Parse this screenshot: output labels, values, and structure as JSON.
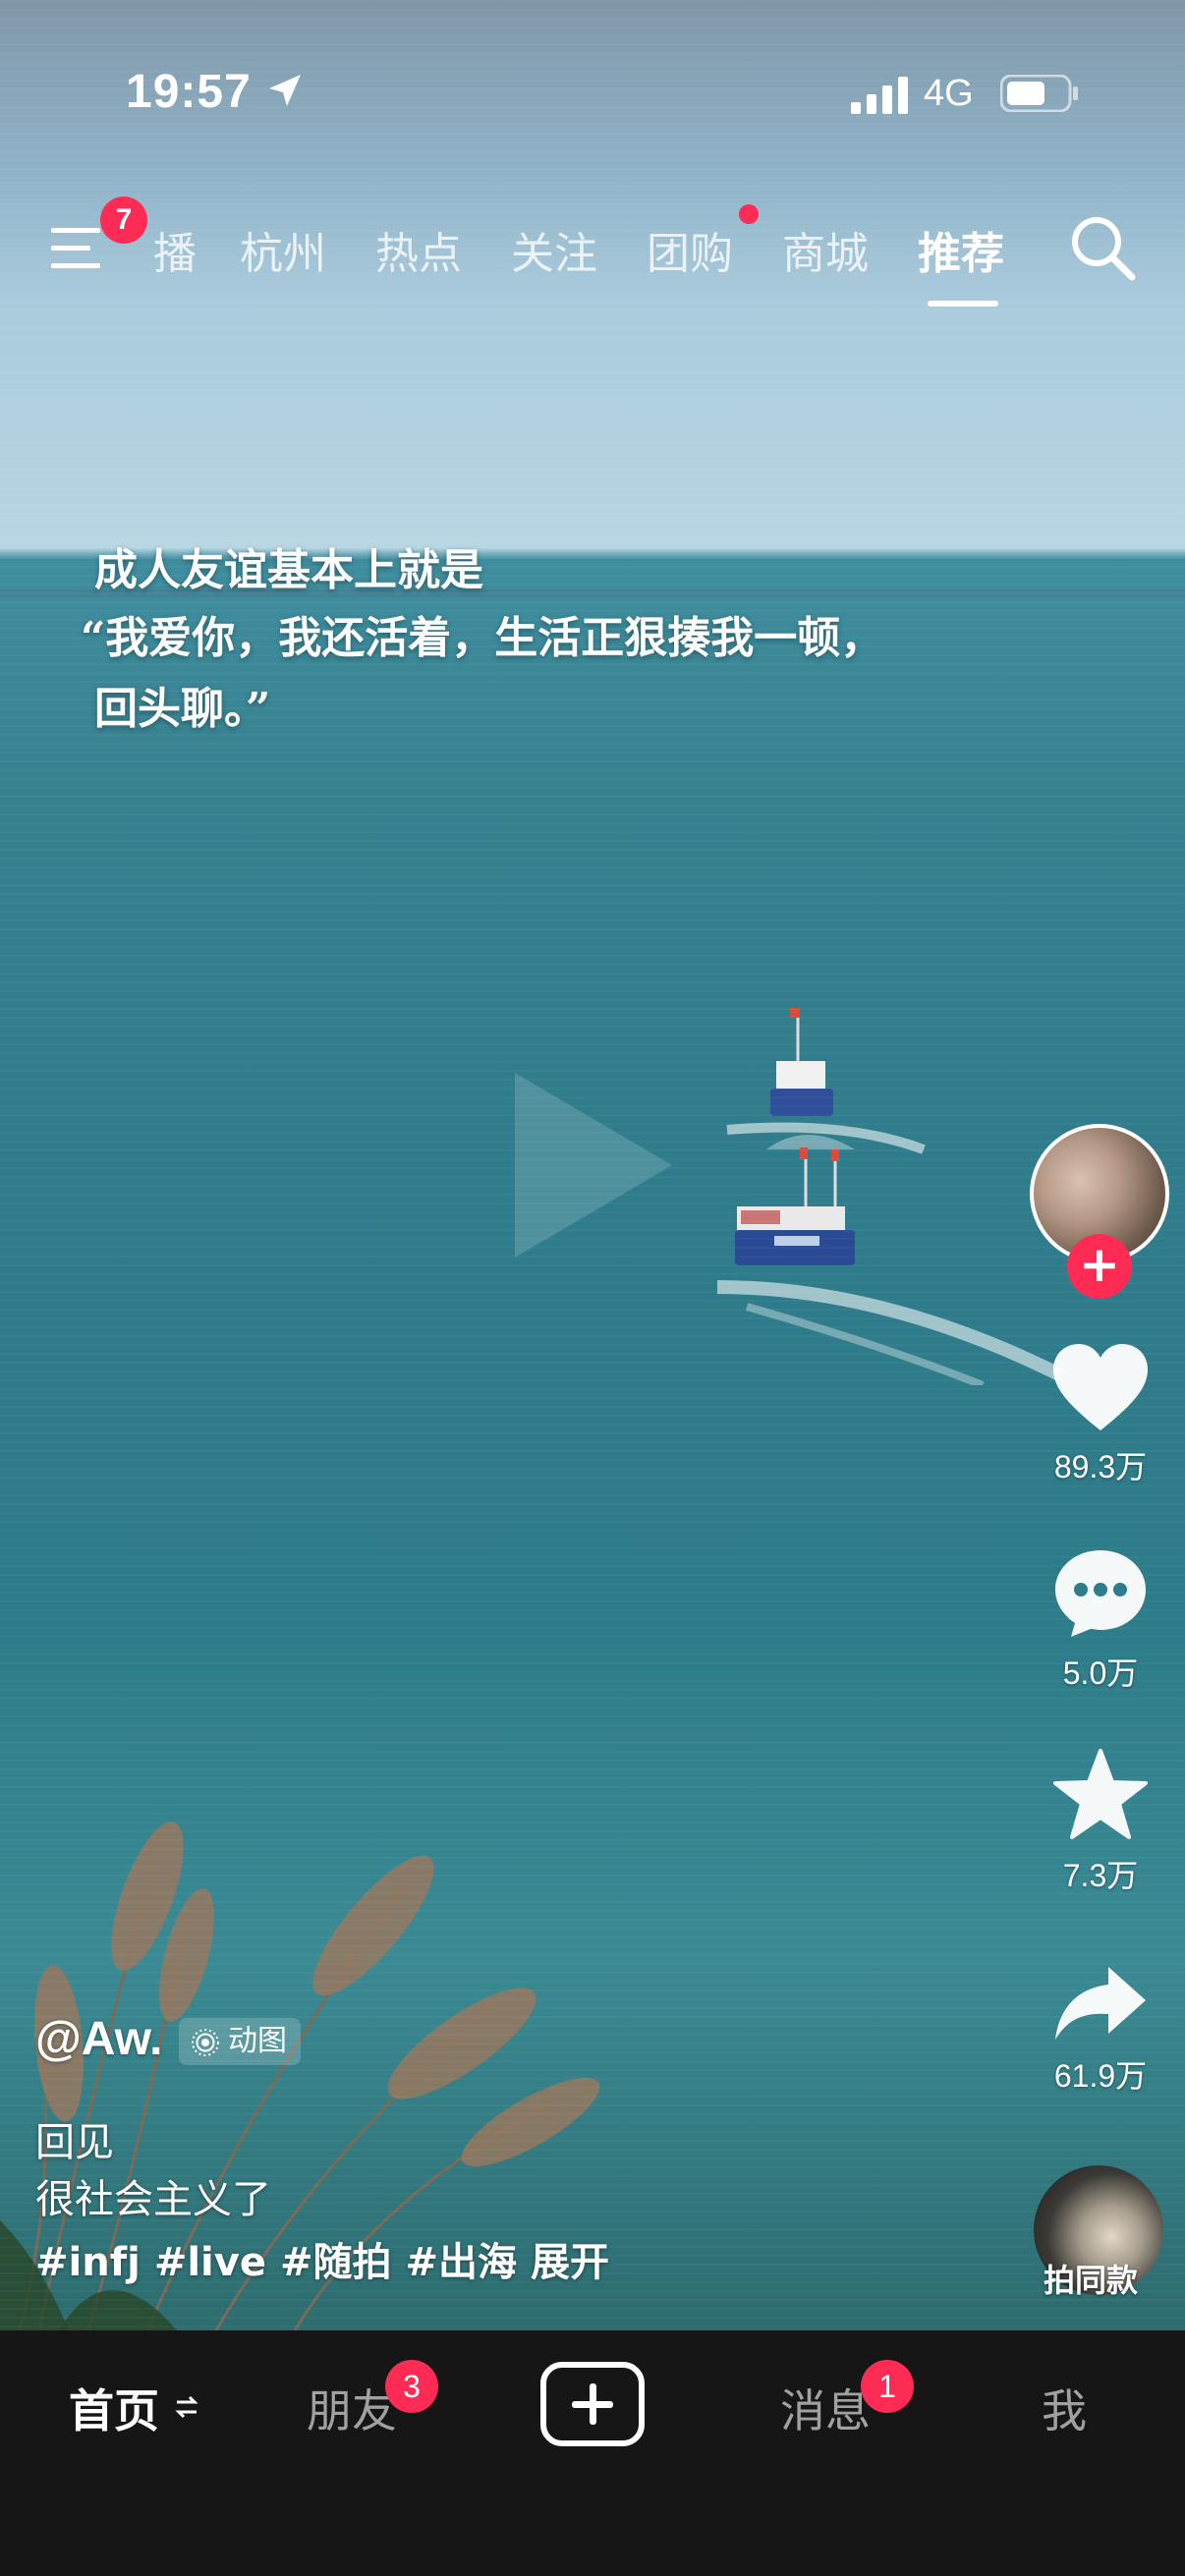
{
  "status_bar": {
    "time": "19:57",
    "network": "4G"
  },
  "top_nav": {
    "menu_badge": "7",
    "tabs": [
      "播",
      "杭州",
      "热点",
      "关注",
      "团购",
      "商城",
      "推荐"
    ],
    "active_tab": "推荐"
  },
  "video": {
    "quote_lines": [
      "成人友谊基本上就是",
      "“我爱你，我还活着，生活正狠揍我一顿，",
      "回头聊。”"
    ]
  },
  "actions": {
    "likes": "89.3万",
    "comments": "5.0万",
    "favorites": "7.3万",
    "shares": "61.9万",
    "same_style_label": "拍同款"
  },
  "caption": {
    "author": "@Aw.",
    "type_tag": "动图",
    "lines": [
      "回见",
      "很社会主义了"
    ],
    "hashtags": [
      "#infj",
      "#live",
      "#随拍",
      "#出海"
    ],
    "expand": "展开"
  },
  "bottom_nav": {
    "home": "首页",
    "friends": "朋友",
    "friends_badge": "3",
    "messages": "消息",
    "messages_badge": "1",
    "me": "我"
  },
  "colors": {
    "accent": "#fe2c55",
    "nav_bg": "#161616",
    "sea": "#2f7c8c"
  }
}
